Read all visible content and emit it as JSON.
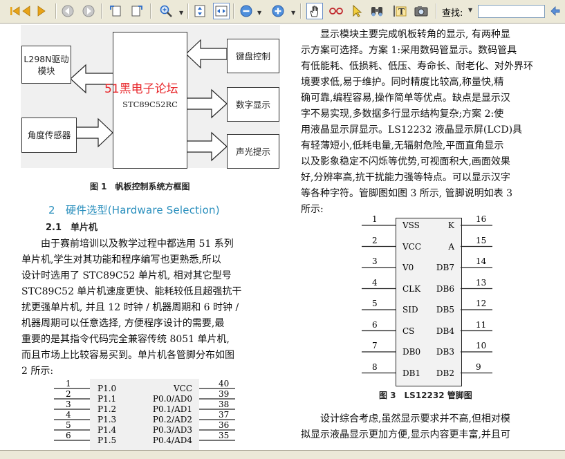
{
  "toolbar": {
    "search_label": "查找:",
    "search_value": ""
  },
  "figure1": {
    "cpu": "STC89C52RC",
    "l298n": "L298N驱动模块",
    "angle": "角度传感器",
    "keyboard": "键盘控制",
    "digital": "数字显示",
    "sound": "声光提示",
    "watermark": "51黑电子论坛",
    "caption": "图 1　帆板控制系统方框图"
  },
  "section2": {
    "heading": "2　硬件选型(Hardware Selection)",
    "sub": "2.1　单片机"
  },
  "left_paragraph": [
    "　　由于赛前培训以及教学过程中都选用 51 系列",
    "单片机,学生对其功能和程序编写也更熟悉,所以",
    "设计时选用了 STC89C52 单片机, 相对其它型号",
    "STC89C52 单片机速度更快、能耗较低且超强抗干",
    "扰更强单片机, 并且 12 时钟 / 机器周期和 6 时钟 /",
    "机器周期可以任意选择, 方便程序设计的需要,最",
    "重要的是其指令代码完全兼容传统 8051 单片机,",
    "而且市场上比较容易买到。单片机各管脚分布如图",
    "2 所示:"
  ],
  "right_paragraph": [
    "　　显示模块主要完成帆板转角的显示, 有两种显",
    "示方案可选择。方案 1:采用数码管显示。数码管具",
    "有低能耗、低损耗、低压、寿命长、耐老化、对外界环",
    "境要求低,易于维护。同时精度比较高,称量快,精",
    "确可靠,编程容易,操作简单等优点。缺点是显示汉",
    "字不易实现,多数据多行显示结构复杂;方案 2:使",
    "用液晶显示屏显示。LS12232 液晶显示屏(LCD)具",
    "有轻薄短小,低耗电量,无辐射危险,平面直角显示",
    "以及影象稳定不闪烁等优势,可视面积大,画面效果",
    "好,分辨率高,抗干扰能力强等特点。可以显示汉字",
    "等各种字符。管脚图如图 3 所示, 管脚说明如表 3",
    "所示:"
  ],
  "lcd": {
    "left_pins": [
      {
        "num": "1",
        "name": "VSS"
      },
      {
        "num": "2",
        "name": "VCC"
      },
      {
        "num": "3",
        "name": "V0"
      },
      {
        "num": "4",
        "name": "CLK"
      },
      {
        "num": "5",
        "name": "SID"
      },
      {
        "num": "6",
        "name": "CS"
      },
      {
        "num": "7",
        "name": "DB0"
      },
      {
        "num": "8",
        "name": "DB1"
      }
    ],
    "right_pins": [
      {
        "num": "16",
        "name": "K"
      },
      {
        "num": "15",
        "name": "A"
      },
      {
        "num": "14",
        "name": "DB7"
      },
      {
        "num": "13",
        "name": "DB6"
      },
      {
        "num": "12",
        "name": "DB5"
      },
      {
        "num": "11",
        "name": "DB4"
      },
      {
        "num": "10",
        "name": "DB3"
      },
      {
        "num": "9",
        "name": "DB2"
      }
    ],
    "caption": "图 3　LS12232 管脚图"
  },
  "right_paragraph2": [
    "　　设计综合考虑,虽然显示要求并不高,但相对模",
    "拟显示液晶显示更加方便,显示内容更丰富,并且可"
  ],
  "mcu": {
    "left_pins": [
      {
        "num": "1",
        "name": "P1.0"
      },
      {
        "num": "2",
        "name": "P1.1"
      },
      {
        "num": "3",
        "name": "P1.2"
      },
      {
        "num": "4",
        "name": "P1.3"
      },
      {
        "num": "5",
        "name": "P1.4"
      },
      {
        "num": "6",
        "name": "P1.5"
      }
    ],
    "right_pins": [
      {
        "num": "40",
        "name": "VCC"
      },
      {
        "num": "39",
        "name": "P0.0/AD0"
      },
      {
        "num": "38",
        "name": "P0.1/AD1"
      },
      {
        "num": "37",
        "name": "P0.2/AD2"
      },
      {
        "num": "36",
        "name": "P0.3/AD3"
      },
      {
        "num": "35",
        "name": "P0.4/AD4"
      }
    ]
  },
  "colors": {
    "heading": "#2a8fbd",
    "watermark": "#e8262a",
    "toolbar": "#ece9d8",
    "nav_arrow": "#e8a317"
  }
}
